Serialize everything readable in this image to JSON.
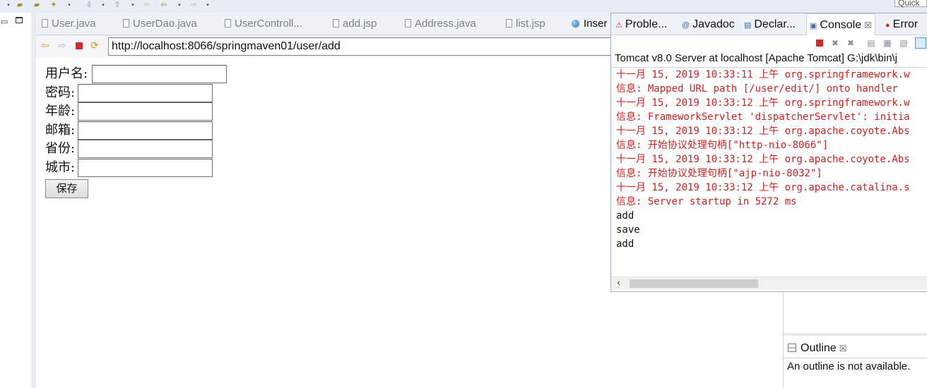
{
  "toolbar": {
    "quick_access": "Quick"
  },
  "editor": {
    "tabs": [
      {
        "label": "User.java",
        "icon": "java-file-icon"
      },
      {
        "label": "UserDao.java",
        "icon": "java-file-icon"
      },
      {
        "label": "UserControll...",
        "icon": "java-file-icon"
      },
      {
        "label": "add.jsp",
        "icon": "jsp-file-icon"
      },
      {
        "label": "Address.java",
        "icon": "java-file-icon"
      },
      {
        "label": "list.jsp",
        "icon": "jsp-file-icon"
      },
      {
        "label": "Inser",
        "icon": "globe-icon"
      }
    ]
  },
  "browser": {
    "url": "http://localhost:8066/springmaven01/user/add"
  },
  "form": {
    "fields": [
      {
        "label": "用户名:"
      },
      {
        "label": "密码:"
      },
      {
        "label": "年龄:"
      },
      {
        "label": "邮箱:"
      },
      {
        "label": "省份:"
      },
      {
        "label": "城市:"
      }
    ],
    "save_label": "保存"
  },
  "console": {
    "tabs": [
      {
        "label": "Proble...",
        "icon": "problems-icon"
      },
      {
        "label": "Javadoc",
        "icon": "javadoc-icon"
      },
      {
        "label": "Declar...",
        "icon": "declaration-icon"
      },
      {
        "label": "Console",
        "icon": "console-icon",
        "close": "☒"
      },
      {
        "label": "Error",
        "icon": "error-log-icon"
      }
    ],
    "title": "Tomcat v8.0 Server at localhost [Apache Tomcat] G:\\jdk\\bin\\j",
    "lines": [
      {
        "text": "十一月 15, 2019 10:33:11 上午 org.springframework.w",
        "color": "#d11f1f"
      },
      {
        "text": "信息: Mapped URL path [/user/edit/] onto handler",
        "color": "#d11f1f"
      },
      {
        "text": "十一月 15, 2019 10:33:12 上午 org.springframework.w",
        "color": "#d11f1f"
      },
      {
        "text": "信息: FrameworkServlet 'dispatcherServlet': initia",
        "color": "#d11f1f"
      },
      {
        "text": "十一月 15, 2019 10:33:12 上午 org.apache.coyote.Abs",
        "color": "#d11f1f"
      },
      {
        "text": "信息: 开始协议处理句柄[\"http-nio-8066\"]",
        "color": "#d11f1f"
      },
      {
        "text": "十一月 15, 2019 10:33:12 上午 org.apache.coyote.Abs",
        "color": "#d11f1f"
      },
      {
        "text": "信息: 开始协议处理句柄[\"ajp-nio-8032\"]",
        "color": "#d11f1f"
      },
      {
        "text": "十一月 15, 2019 10:33:12 上午 org.apache.catalina.s",
        "color": "#d11f1f"
      },
      {
        "text": "信息: Server startup in 5272 ms",
        "color": "#d11f1f"
      },
      {
        "text": "add",
        "color": "#111111"
      },
      {
        "text": "save",
        "color": "#111111"
      },
      {
        "text": "add",
        "color": "#111111"
      }
    ]
  },
  "outline": {
    "tab_label": "Outline",
    "close": "☒",
    "message": "An outline is not available."
  }
}
